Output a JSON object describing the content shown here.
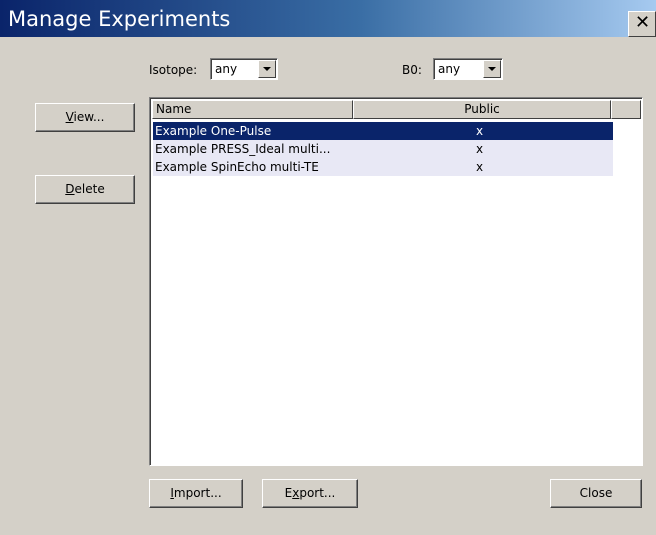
{
  "window": {
    "title": "Manage Experiments",
    "close_glyph": "✕"
  },
  "filters": {
    "isotope_label": "Isotope:",
    "isotope_value": "any",
    "b0_label": "B0:",
    "b0_value": "any"
  },
  "side_buttons": {
    "view_mnemonic": "V",
    "view_rest": "iew...",
    "delete_mnemonic": "D",
    "delete_rest": "elete"
  },
  "table": {
    "columns": [
      "Name",
      "Public"
    ],
    "rows": [
      {
        "name": "Example One-Pulse",
        "public": "x",
        "selected": true
      },
      {
        "name": "Example PRESS_Ideal multi...",
        "public": "x",
        "selected": false
      },
      {
        "name": "Example SpinEcho multi-TE",
        "public": "x",
        "selected": false
      }
    ]
  },
  "bottom_buttons": {
    "import_mnemonic": "I",
    "import_rest": "mport...",
    "export_pre": "E",
    "export_mnemonic": "x",
    "export_rest": "port...",
    "close_label": "Close"
  },
  "colors": {
    "selection": "#0a246a",
    "row_stripe": "#e8e8f5",
    "dialog_bg": "#d4d0c8"
  }
}
